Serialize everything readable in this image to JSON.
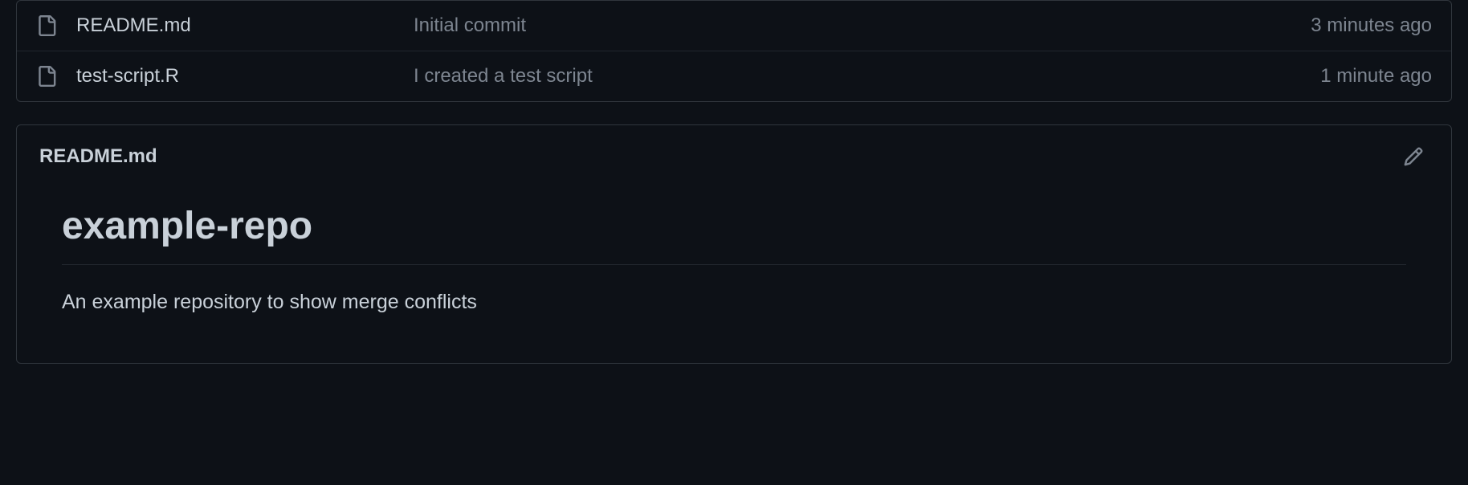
{
  "files": [
    {
      "name": "README.md",
      "commit_message": "Initial commit",
      "time": "3 minutes ago"
    },
    {
      "name": "test-script.R",
      "commit_message": "I created a test script",
      "time": "1 minute ago"
    }
  ],
  "readme": {
    "filename": "README.md",
    "heading": "example-repo",
    "description": "An example repository to show merge conflicts"
  }
}
